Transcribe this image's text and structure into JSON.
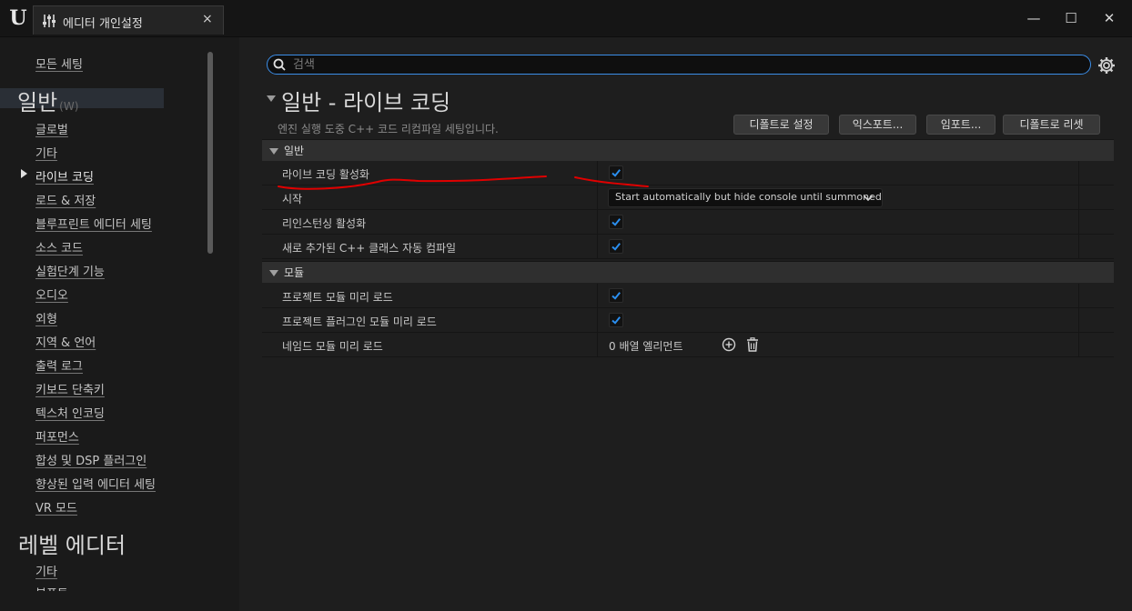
{
  "window": {
    "tab_title": "에디터 개인설정",
    "tab_close": "×",
    "minimize": "—",
    "maximize": "☐",
    "close": "✕",
    "logo_letter": "U"
  },
  "sidebar": {
    "all_settings": "모든 세팅",
    "category_general": "일반",
    "category_general_hint": "(W)",
    "general_items": [
      "글로벌",
      "기타",
      "라이브 코딩",
      "로드 & 저장",
      "블루프린트 에디터 세팅",
      "소스 코드",
      "실험단계 기능",
      "오디오",
      "외형",
      "지역 & 언어",
      "출력 로그",
      "키보드 단축키",
      "텍스처 인코딩",
      "퍼포먼스",
      "합성 및 DSP 플러그인",
      "향상된 입력 에디터 세팅",
      "VR 모드"
    ],
    "category_level_editor": "레벨 에디터",
    "level_editor_items": [
      "기타",
      "뷰포트"
    ]
  },
  "search": {
    "placeholder": "검색",
    "value": ""
  },
  "header": {
    "title": "일반 - 라이브 코딩",
    "description": "엔진 실행 도중 C++ 코드 리컴파일 세팅입니다."
  },
  "actions": {
    "set_default": "디폴트로 설정",
    "export": "익스포트...",
    "import": "임포트...",
    "reset_default": "디폴트로 리셋"
  },
  "sections": {
    "general": {
      "label": "일반",
      "rows": {
        "enable_live_coding": {
          "label": "라이브 코딩 활성화",
          "checked": true
        },
        "startup": {
          "label": "시작",
          "value": "Start automatically but hide console until summoned"
        },
        "enable_reinstancing": {
          "label": "리인스턴싱 활성화",
          "checked": true
        },
        "auto_compile_new_classes": {
          "label": "새로 추가된 C++ 클래스 자동 컴파일",
          "checked": true
        }
      }
    },
    "modules": {
      "label": "모듈",
      "rows": {
        "preload_project_modules": {
          "label": "프로젝트 모듈 미리 로드",
          "checked": true
        },
        "preload_project_plugin_modules": {
          "label": "프로젝트 플러그인 모듈 미리 로드",
          "checked": true
        },
        "preload_named_modules": {
          "label": "네임드 모듈 미리 로드",
          "array_text": "0 배열 엘리먼트"
        }
      }
    }
  },
  "colors": {
    "accent_blue": "#3c8ee8",
    "checkbox_check": "#2b8ff0",
    "annotation_red": "#e00000"
  }
}
